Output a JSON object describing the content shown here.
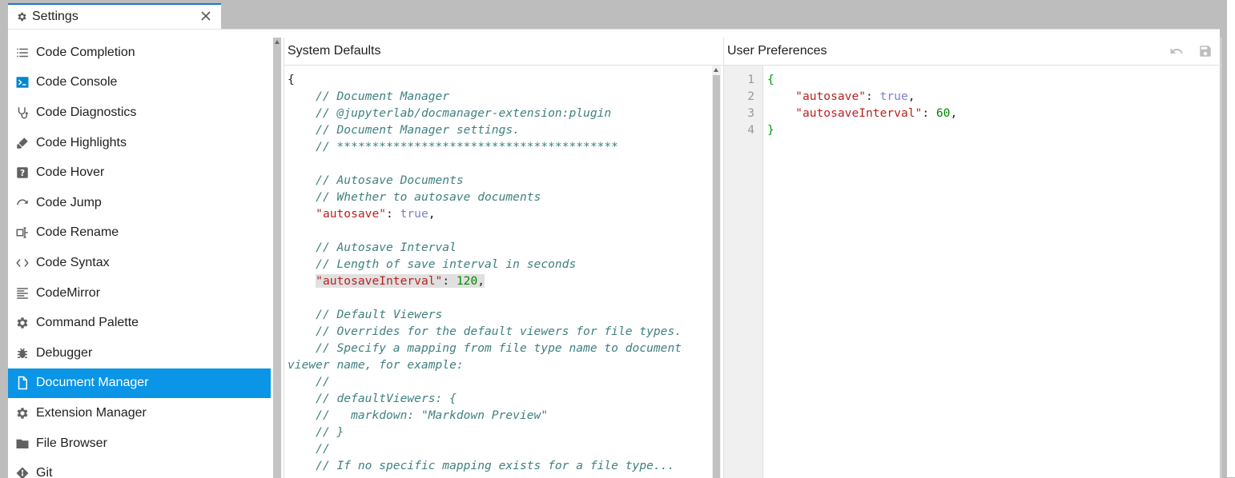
{
  "tab": {
    "title": "Settings",
    "icon": "gear-icon",
    "close_icon": "close-icon"
  },
  "sidebar": {
    "items": [
      {
        "label": "Code Completion",
        "icon": "list-icon"
      },
      {
        "label": "Code Console",
        "icon": "console-icon"
      },
      {
        "label": "Code Diagnostics",
        "icon": "stethoscope-icon"
      },
      {
        "label": "Code Highlights",
        "icon": "highlighter-icon"
      },
      {
        "label": "Code Hover",
        "icon": "question-icon"
      },
      {
        "label": "Code Jump",
        "icon": "jump-arrow-icon"
      },
      {
        "label": "Code Rename",
        "icon": "rename-icon"
      },
      {
        "label": "Code Syntax",
        "icon": "code-syntax-icon"
      },
      {
        "label": "CodeMirror",
        "icon": "text-lines-icon"
      },
      {
        "label": "Command Palette",
        "icon": "gear-icon"
      },
      {
        "label": "Debugger",
        "icon": "bug-icon"
      },
      {
        "label": "Document Manager",
        "icon": "document-icon",
        "active": true
      },
      {
        "label": "Extension Manager",
        "icon": "gear-icon"
      },
      {
        "label": "File Browser",
        "icon": "folder-icon"
      },
      {
        "label": "Git",
        "icon": "git-icon"
      }
    ],
    "active_color": "#0a95e6"
  },
  "system_defaults": {
    "title": "System Defaults",
    "lines": [
      "{",
      "    // Document Manager",
      "    // @jupyterlab/docmanager-extension:plugin",
      "    // Document Manager settings.",
      "    // ****************************************",
      "",
      "    // Autosave Documents",
      "    // Whether to autosave documents",
      "    \"autosave\": true,",
      "",
      "    // Autosave Interval",
      "    // Length of save interval in seconds",
      "    \"autosaveInterval\": 120,",
      "",
      "    // Default Viewers",
      "    // Overrides for the default viewers for file types.",
      "    // Specify a mapping from file type name to document viewer name, for example:",
      "    //",
      "    // defaultViewers: {",
      "    //   markdown: \"Markdown Preview\"",
      "    // }",
      "    //",
      "    // If no specific mapping exists for a file type..."
    ]
  },
  "user_preferences": {
    "title": "User Preferences",
    "line_numbers": [
      "1",
      "2",
      "3",
      "4"
    ],
    "lines": [
      "{",
      "    \"autosave\": true,",
      "    \"autosaveInterval\": 60,",
      "}"
    ],
    "toolbar": {
      "revert_icon": "undo-icon",
      "save_icon": "save-icon"
    }
  }
}
